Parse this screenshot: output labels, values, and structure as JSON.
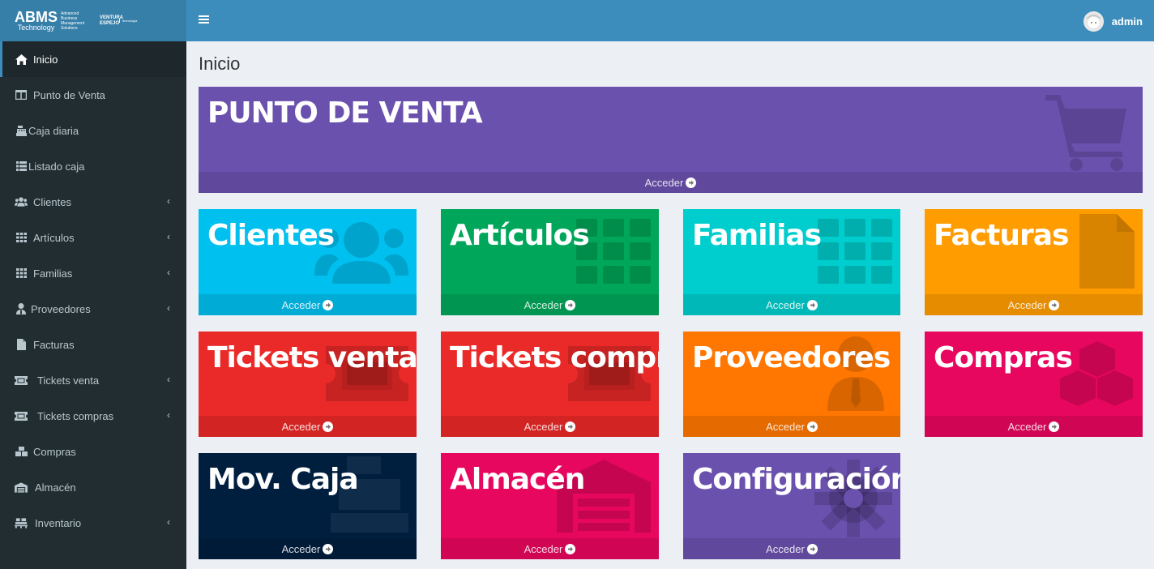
{
  "logo": {
    "main": "ABMS",
    "sub": "Technology",
    "tagline": "Advanced Business Management Solutions",
    "partner": "VENTURA ESPEJO",
    "partner_tag": "Tecnología"
  },
  "sidebar": {
    "items": [
      {
        "label": "Inicio",
        "icon": "home-icon",
        "active": true,
        "expandable": false
      },
      {
        "label": "Punto de Venta",
        "icon": "columns-icon",
        "active": false,
        "expandable": false
      },
      {
        "label": "Caja diaria",
        "icon": "cash-register-icon",
        "active": false,
        "expandable": false
      },
      {
        "label": "Listado caja",
        "icon": "list-icon",
        "active": false,
        "expandable": false
      },
      {
        "label": "Clientes",
        "icon": "users-icon",
        "active": false,
        "expandable": true
      },
      {
        "label": "Artículos",
        "icon": "grid-icon",
        "active": false,
        "expandable": true
      },
      {
        "label": "Familias",
        "icon": "grid-icon",
        "active": false,
        "expandable": true
      },
      {
        "label": "Proveedores",
        "icon": "user-tie-icon",
        "active": false,
        "expandable": true
      },
      {
        "label": "Facturas",
        "icon": "file-icon",
        "active": false,
        "expandable": false
      },
      {
        "label": "Tickets venta",
        "icon": "ticket-icon",
        "active": false,
        "expandable": true
      },
      {
        "label": "Tickets compras",
        "icon": "ticket-icon",
        "active": false,
        "expandable": true
      },
      {
        "label": "Compras",
        "icon": "cubes-icon",
        "active": false,
        "expandable": false
      },
      {
        "label": "Almacén",
        "icon": "warehouse-icon",
        "active": false,
        "expandable": false
      },
      {
        "label": "Inventario",
        "icon": "pallet-icon",
        "active": false,
        "expandable": true
      }
    ]
  },
  "header": {
    "username": "admin"
  },
  "page_title": "Inicio",
  "tiles": {
    "footer_label": "Acceder",
    "items": [
      {
        "title": "PUNTO DE VENTA",
        "color": "#6b51ae",
        "icon": "shopping-cart-icon"
      },
      {
        "title": "Clientes",
        "color": "#00c0ef",
        "icon": "users-icon"
      },
      {
        "title": "Artículos",
        "color": "#00a65a",
        "icon": "grid-icon"
      },
      {
        "title": "Familias",
        "color": "#00cdcd",
        "icon": "grid-icon"
      },
      {
        "title": "Facturas",
        "color": "#ff9c00",
        "icon": "file-icon"
      },
      {
        "title": "Tickets venta",
        "color": "#ea2a28",
        "icon": "ticket-icon"
      },
      {
        "title": "Tickets compra",
        "color": "#ea2a28",
        "icon": "ticket-icon"
      },
      {
        "title": "Proveedores",
        "color": "#ff7701",
        "icon": "user-tie-icon"
      },
      {
        "title": "Compras",
        "color": "#e8075f",
        "icon": "cubes-icon"
      },
      {
        "title": "Mov. Caja",
        "color": "#001f3f",
        "icon": "cash-register-icon"
      },
      {
        "title": "Almacén",
        "color": "#e8075f",
        "icon": "warehouse-icon"
      },
      {
        "title": "Configuración",
        "color": "#6b51ae",
        "icon": "cog-icon"
      }
    ]
  }
}
